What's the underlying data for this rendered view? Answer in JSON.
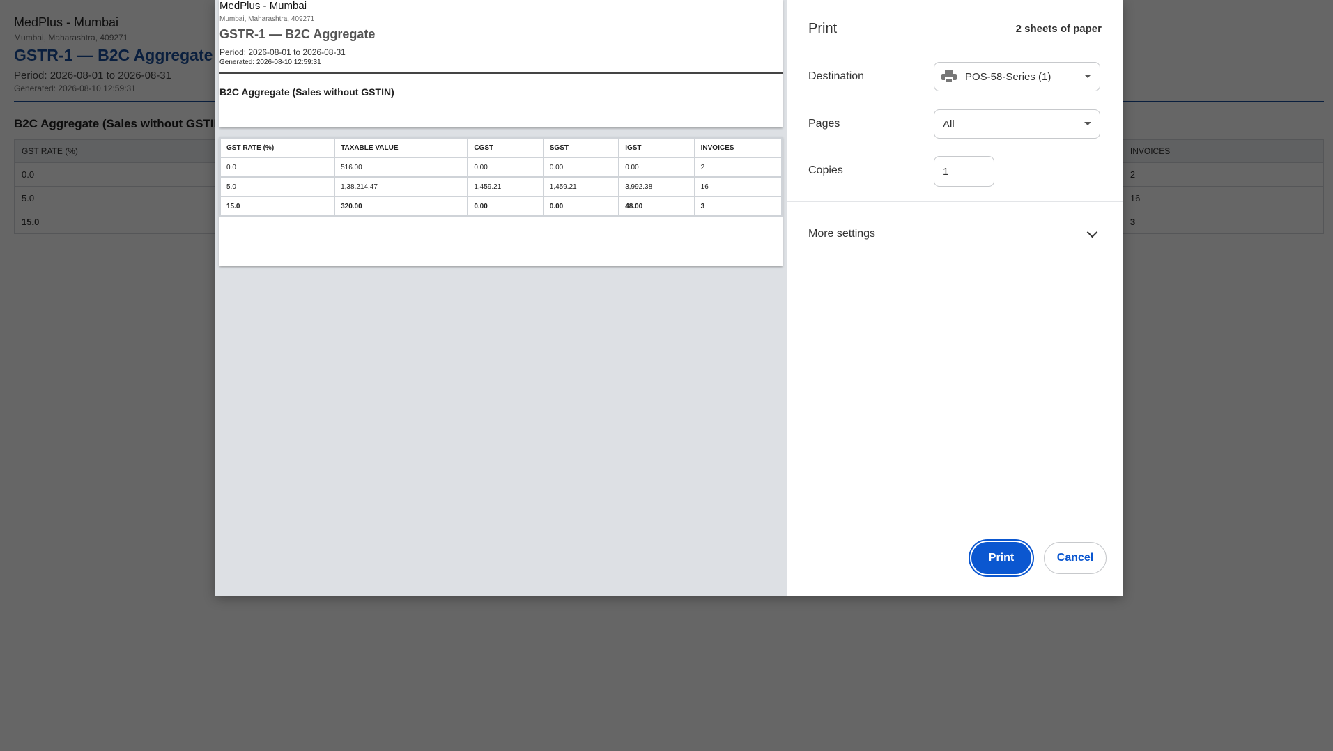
{
  "background": {
    "store_name": "MedPlus - Mumbai",
    "address": "Mumbai, Maharashtra, 409271",
    "title": "GSTR-1 — B2C Aggregate",
    "period": "Period: 2026-08-01 to 2026-08-31",
    "generated": "Generated: 2026-08-10 12:59:31",
    "section_title": "B2C Aggregate (Sales without GSTIN)",
    "columns": [
      "GST RATE (%)",
      "TAXABLE VALUE",
      "CGST",
      "SGST",
      "IGST",
      "INVOICES"
    ],
    "rows": [
      [
        "0.0",
        "516.00",
        "0.00",
        "0.00",
        "0.00",
        "2"
      ],
      [
        "5.0",
        "1,38,214.47",
        "1,459.21",
        "1,459.21",
        "3,992.38",
        "16"
      ],
      [
        "15.0",
        "320.00",
        "0.00",
        "0.00",
        "48.00",
        "3"
      ]
    ]
  },
  "dialog": {
    "title": "Print",
    "sheets": "2 sheets of paper",
    "destination_label": "Destination",
    "destination_value": "POS-58-Series (1)",
    "pages_label": "Pages",
    "pages_value": "All",
    "copies_label": "Copies",
    "copies_value": "1",
    "more_settings": "More settings",
    "print_button": "Print",
    "cancel_button": "Cancel"
  },
  "colors": {
    "accent": "#0b57d0",
    "title_blue": "#1a4f9c"
  }
}
